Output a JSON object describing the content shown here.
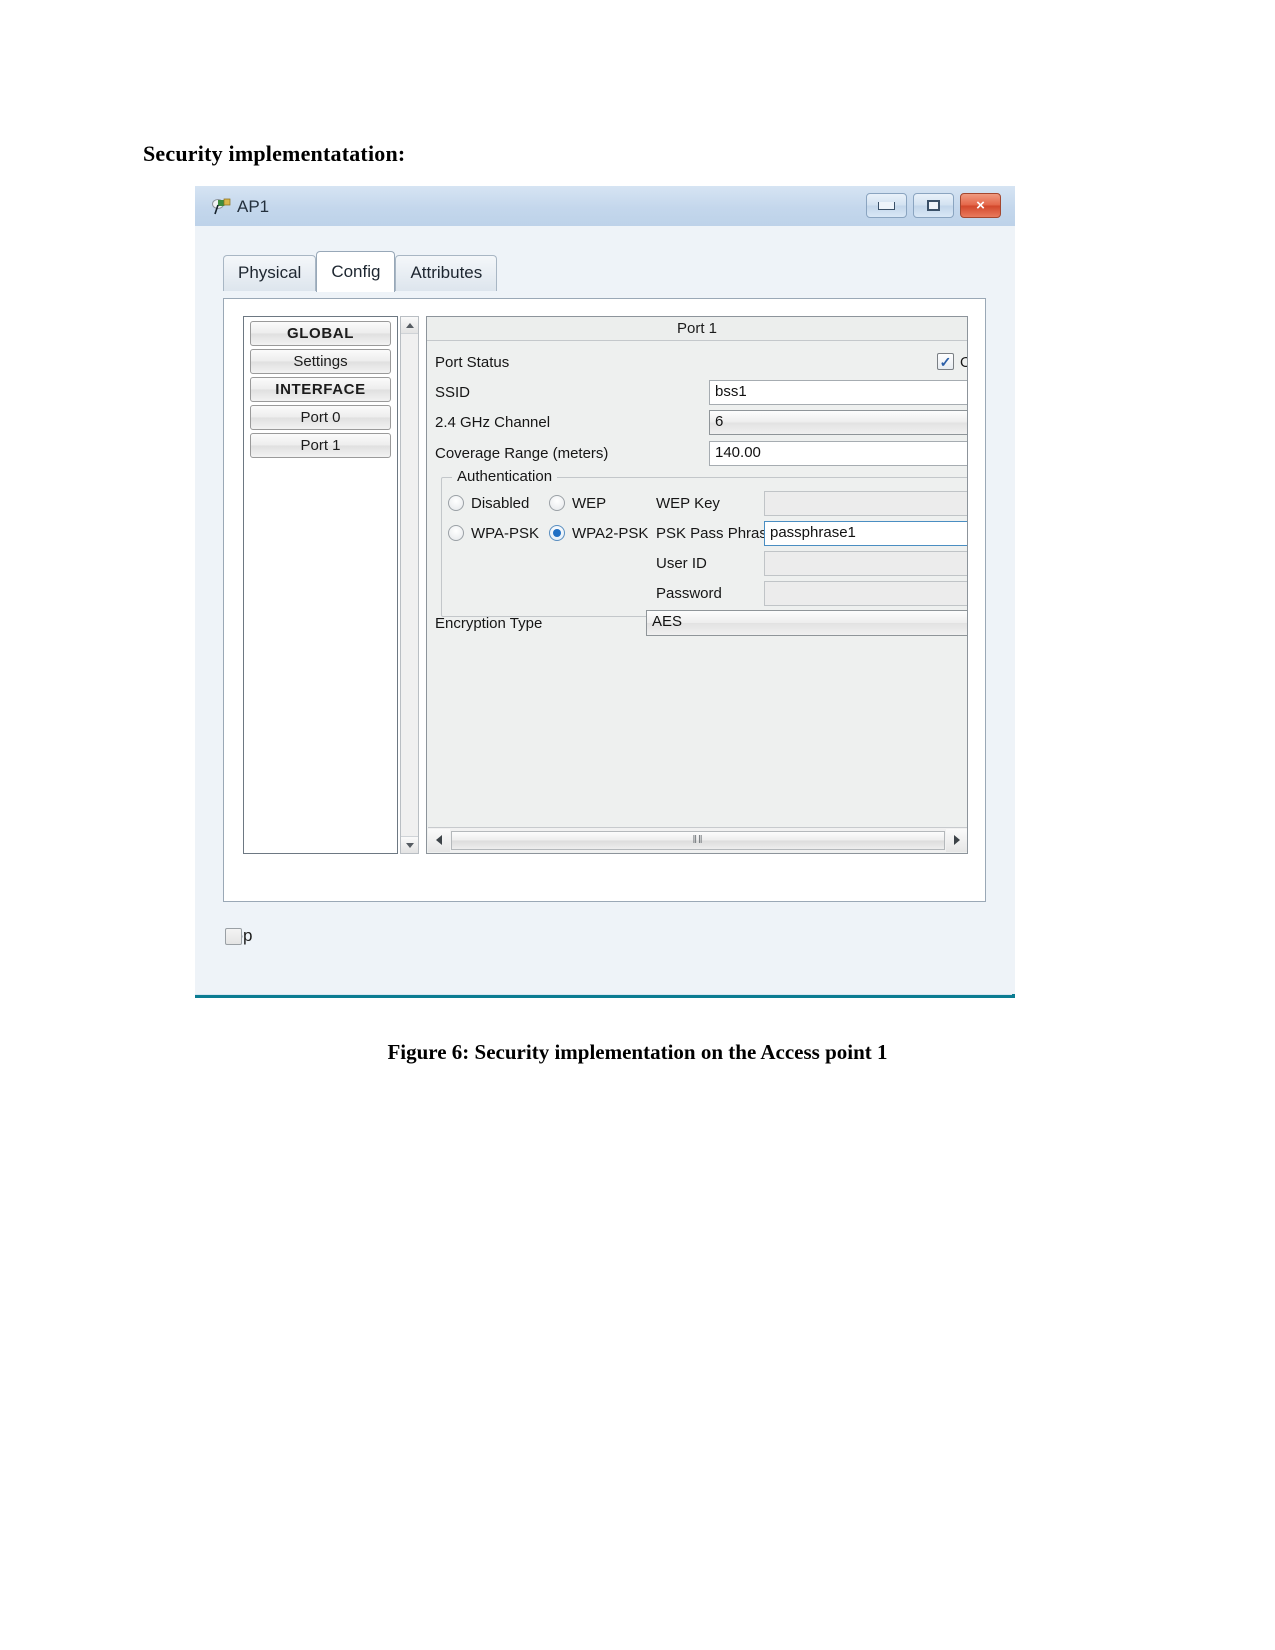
{
  "document": {
    "heading": "Security implementatation:",
    "caption": "Figure 6: Security implementation on the Access point 1"
  },
  "window": {
    "title": "AP1",
    "icon": "access-point-icon",
    "controls": {
      "minimize": "—",
      "maximize": "□",
      "close": "×"
    }
  },
  "tabs": [
    {
      "label": "Physical",
      "active": false
    },
    {
      "label": "Config",
      "active": true
    },
    {
      "label": "Attributes",
      "active": false
    }
  ],
  "sidebar": {
    "items": [
      {
        "label": "GLOBAL",
        "header": true
      },
      {
        "label": "Settings",
        "header": false
      },
      {
        "label": "INTERFACE",
        "header": true
      },
      {
        "label": "Port 0",
        "header": false
      },
      {
        "label": "Port 1",
        "header": false
      }
    ]
  },
  "form": {
    "port_title": "Port 1",
    "port_status": {
      "label": "Port Status",
      "checkbox_checked": true,
      "value_label": "On"
    },
    "ssid": {
      "label": "SSID",
      "value": "bss1"
    },
    "channel": {
      "label": "2.4 GHz Channel",
      "value": "6"
    },
    "coverage": {
      "label": "Coverage Range (meters)",
      "value": "140.00"
    },
    "authentication": {
      "legend": "Authentication",
      "options": [
        {
          "label": "Disabled",
          "selected": false
        },
        {
          "label": "WEP",
          "selected": false
        },
        {
          "label": "WPA-PSK",
          "selected": false
        },
        {
          "label": "WPA2-PSK",
          "selected": true
        }
      ],
      "fields": [
        {
          "label": "WEP Key",
          "value": "",
          "enabled": false,
          "focused": false
        },
        {
          "label": "PSK Pass Phrase",
          "value": "passphrase1",
          "enabled": true,
          "focused": true
        },
        {
          "label": "User ID",
          "value": "",
          "enabled": false,
          "focused": false
        },
        {
          "label": "Password",
          "value": "",
          "enabled": false,
          "focused": false
        }
      ]
    },
    "encryption": {
      "label": "Encryption Type",
      "value": "AES"
    }
  },
  "scrollbars": {
    "horizontal_thumb_glyph": "‖‖",
    "left_arrow": "left-arrow-icon",
    "right_arrow": "right-arrow-icon",
    "up_arrow": "up-arrow-icon",
    "down_arrow": "down-arrow-icon"
  },
  "footer": {
    "top_checkbox": {
      "label": "Top",
      "checked": false
    }
  },
  "colors": {
    "titlebar": "#c4d7ec",
    "accent_border": "#0b7c92",
    "radio_selected": "#1f6fc4",
    "checkbox_tick": "#2b5fa8",
    "close_button": "#d2472b"
  }
}
